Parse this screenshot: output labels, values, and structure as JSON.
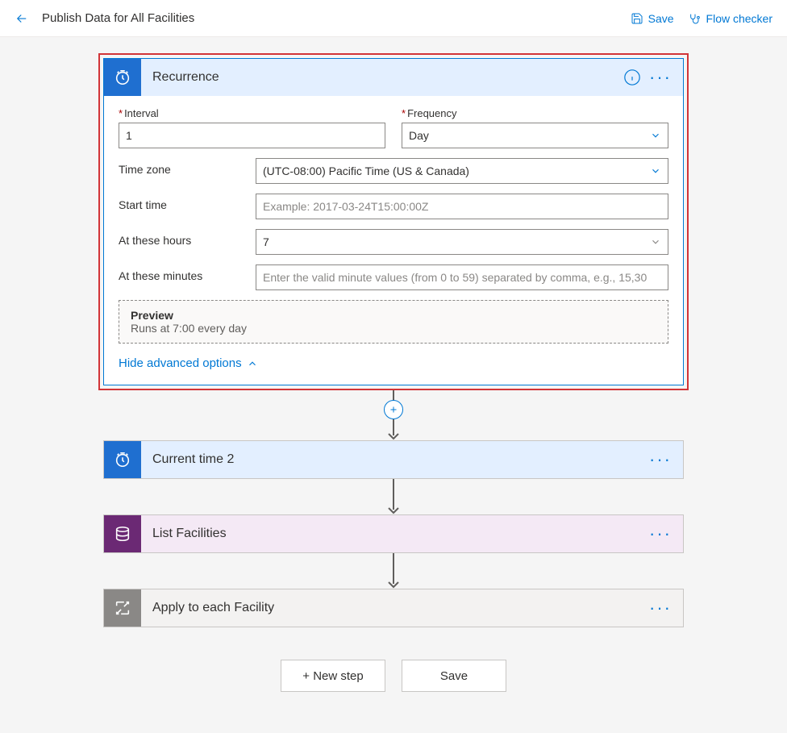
{
  "header": {
    "title": "Publish Data for All Facilities",
    "save": "Save",
    "flowChecker": "Flow checker"
  },
  "recurrence": {
    "title": "Recurrence",
    "intervalLabel": "Interval",
    "intervalValue": "1",
    "frequencyLabel": "Frequency",
    "frequencyValue": "Day",
    "timeZoneLabel": "Time zone",
    "timeZoneValue": "(UTC-08:00) Pacific Time (US & Canada)",
    "startTimeLabel": "Start time",
    "startTimePlaceholder": "Example: 2017-03-24T15:00:00Z",
    "atHoursLabel": "At these hours",
    "atHoursValue": "7",
    "atMinutesLabel": "At these minutes",
    "atMinutesPlaceholder": "Enter the valid minute values (from 0 to 59) separated by comma, e.g., 15,30",
    "previewTitle": "Preview",
    "previewText": "Runs at 7:00 every day",
    "hideAdvanced": "Hide advanced options"
  },
  "steps": {
    "currentTime": "Current time 2",
    "listFacilities": "List Facilities",
    "applyToEach": "Apply to each Facility"
  },
  "actions": {
    "newStep": "+ New step",
    "save": "Save"
  }
}
